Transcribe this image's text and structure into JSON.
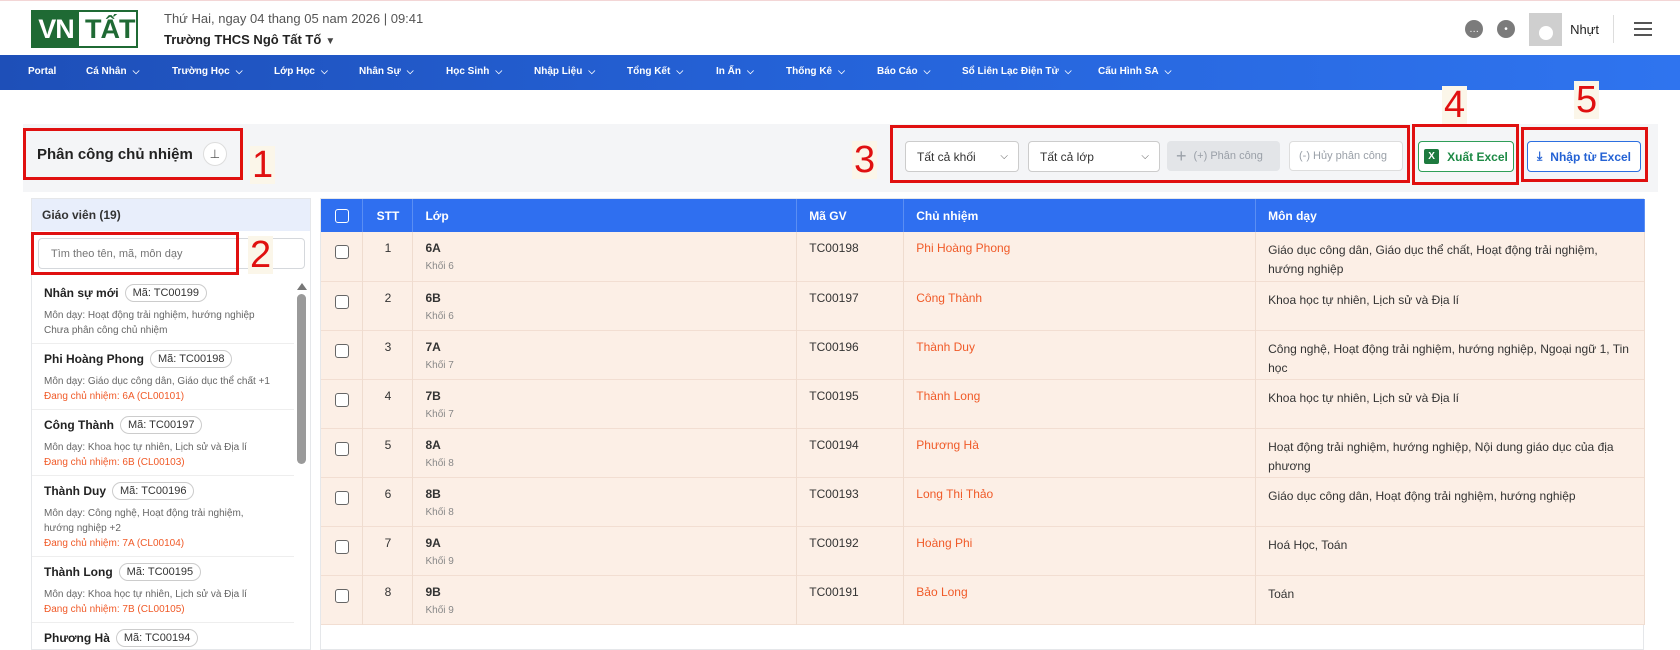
{
  "header": {
    "logo": "VN TẤT",
    "datetime": "Thứ Hai, ngay 04 thang 05 nam 2026 | 09:41",
    "school": "Trường THCS Ngô Tất Tố",
    "username": "Nhựt"
  },
  "nav": [
    "Portal",
    "Cá Nhân",
    "Trường Học",
    "Lớp Học",
    "Nhân Sự",
    "Học Sinh",
    "Nhập Liệu",
    "Tổng Kết",
    "In Ấn",
    "Thống Kê",
    "Báo Cáo",
    "Sổ Liên Lạc Điện Tử",
    "Cấu Hình SA"
  ],
  "page": {
    "title": "Phân công chủ nhiệm",
    "markers": [
      "1",
      "2",
      "3",
      "4",
      "5"
    ]
  },
  "filters": {
    "grade": "Tất cả khối",
    "class": "Tất cả lớp",
    "assign": "(+) Phân công",
    "cancel": "(-) Hủy phân công",
    "export": "Xuất Excel",
    "import": "Nhập từ Excel"
  },
  "teachers": {
    "heading": "Giáo viên (19)",
    "search_placeholder": "Tìm theo tên, mã, môn dạy",
    "items": [
      {
        "name": "Nhân sự mới",
        "code": "Mã: TC00199",
        "subjects": "Môn dạy: Hoạt động trải nghiệm, hướng nghiệp",
        "status": "Chưa phân công chủ nhiệm",
        "assigned": false
      },
      {
        "name": "Phi Hoàng Phong",
        "code": "Mã: TC00198",
        "subjects": "Môn dạy: Giáo dục công dân, Giáo dục thể chất +1",
        "status": "Đang chủ nhiệm: 6A (CL00101)",
        "assigned": true
      },
      {
        "name": "Công Thành",
        "code": "Mã: TC00197",
        "subjects": "Môn dạy: Khoa học tự nhiên, Lịch sử và Địa lí",
        "status": "Đang chủ nhiệm: 6B (CL00103)",
        "assigned": true
      },
      {
        "name": "Thành Duy",
        "code": "Mã: TC00196",
        "subjects": "Môn dạy: Công nghệ, Hoạt động trải nghiệm, hướng nghiệp +2",
        "status": "Đang chủ nhiệm: 7A (CL00104)",
        "assigned": true
      },
      {
        "name": "Thành Long",
        "code": "Mã: TC00195",
        "subjects": "Môn dạy: Khoa học tự nhiên, Lịch sử và Địa lí",
        "status": "Đang chủ nhiệm: 7B (CL00105)",
        "assigned": true
      },
      {
        "name": "Phương Hà",
        "code": "Mã: TC00194",
        "subjects": "",
        "status": "",
        "assigned": true
      }
    ]
  },
  "table": {
    "columns": [
      "STT",
      "Lớp",
      "Mã GV",
      "Chủ nhiệm",
      "Môn dạy"
    ],
    "rows": [
      {
        "stt": "1",
        "class": "6A",
        "grade": "Khối 6",
        "code": "TC00198",
        "teacher": "Phi Hoàng Phong",
        "subjects": "Giáo dục công dân, Giáo dục thể chất, Hoạt động trải nghiệm, hướng nghiệp"
      },
      {
        "stt": "2",
        "class": "6B",
        "grade": "Khối 6",
        "code": "TC00197",
        "teacher": "Công Thành",
        "subjects": "Khoa học tự nhiên, Lịch sử và Địa lí"
      },
      {
        "stt": "3",
        "class": "7A",
        "grade": "Khối 7",
        "code": "TC00196",
        "teacher": "Thành Duy",
        "subjects": "Công nghệ, Hoạt động trải nghiệm, hướng nghiệp, Ngoại ngữ 1, Tin học"
      },
      {
        "stt": "4",
        "class": "7B",
        "grade": "Khối 7",
        "code": "TC00195",
        "teacher": "Thành Long",
        "subjects": "Khoa học tự nhiên, Lịch sử và Địa lí"
      },
      {
        "stt": "5",
        "class": "8A",
        "grade": "Khối 8",
        "code": "TC00194",
        "teacher": "Phương Hà",
        "subjects": "Hoạt động trải nghiệm, hướng nghiệp, Nội dung giáo dục của địa phương"
      },
      {
        "stt": "6",
        "class": "8B",
        "grade": "Khối 8",
        "code": "TC00193",
        "teacher": "Long Thị Thảo",
        "subjects": "Giáo dục công dân, Hoạt động trải nghiệm, hướng nghiệp"
      },
      {
        "stt": "7",
        "class": "9A",
        "grade": "Khối 9",
        "code": "TC00192",
        "teacher": "Hoàng Phi",
        "subjects": "Hoá Học, Toán"
      },
      {
        "stt": "8",
        "class": "9B",
        "grade": "Khối 9",
        "code": "TC00191",
        "teacher": "Bảo Long",
        "subjects": "Toán"
      }
    ]
  },
  "colors": {
    "nav": "#2563d9",
    "accent_orange": "#f05a28",
    "table_header": "#2f6ff0",
    "row_bg": "#fcefe6",
    "marker_red": "#e01010"
  }
}
